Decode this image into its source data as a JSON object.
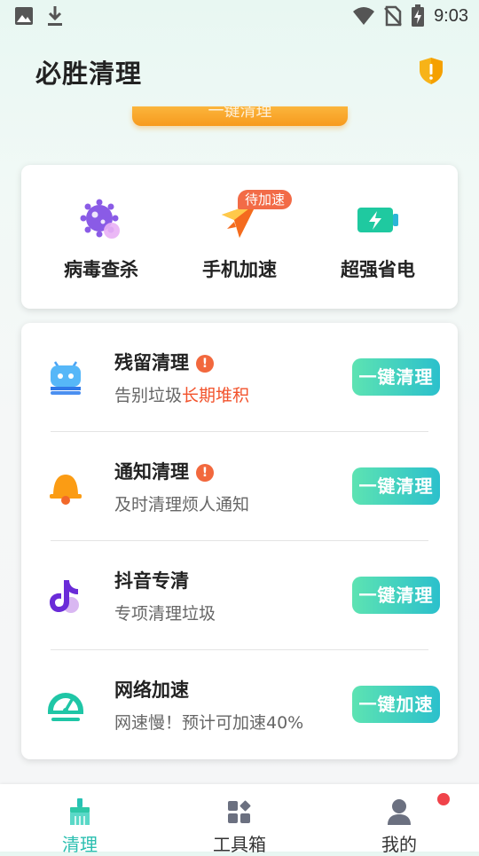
{
  "status_bar": {
    "time": "9:03",
    "icons": [
      "image-icon",
      "download-icon",
      "wifi-icon",
      "no-sim-icon",
      "battery-charging-icon"
    ]
  },
  "header": {
    "title": "必胜清理",
    "shield_icon": "shield-alert-icon",
    "scan_button_label": "一键清理"
  },
  "tools": [
    {
      "label": "病毒查杀",
      "icon": "virus-icon"
    },
    {
      "label": "手机加速",
      "icon": "rocket-icon",
      "badge": "待加速"
    },
    {
      "label": "超强省电",
      "icon": "battery-icon"
    }
  ],
  "list": [
    {
      "title": "残留清理",
      "warn": "!",
      "sub": "告别垃圾",
      "sub_highlight": "长期堆积",
      "button": "一键清理",
      "icon": "android-robot-icon"
    },
    {
      "title": "通知清理",
      "warn": "!",
      "sub": "及时清理烦人通知",
      "sub_highlight": "",
      "button": "一键清理",
      "icon": "bell-icon"
    },
    {
      "title": "抖音专清",
      "warn": "",
      "sub": "专项清理垃圾",
      "sub_highlight": "",
      "button": "一键清理",
      "icon": "tiktok-icon"
    },
    {
      "title": "网络加速",
      "warn": "",
      "sub": "网速慢！预计可加速40%",
      "sub_highlight": "",
      "button": "一键加速",
      "icon": "speedometer-icon"
    }
  ],
  "tabs": [
    {
      "label": "清理",
      "icon": "broom-icon",
      "active": true
    },
    {
      "label": "工具箱",
      "icon": "grid-icon",
      "active": false
    },
    {
      "label": "我的",
      "icon": "user-icon",
      "active": false
    }
  ],
  "colors": {
    "accent": "#2bbfb0",
    "button_gradient_start": "#5de3b2",
    "button_gradient_end": "#2bc0cc",
    "warning": "#f2683d",
    "highlight_text": "#f2522b",
    "orange": "#f79a1e"
  }
}
